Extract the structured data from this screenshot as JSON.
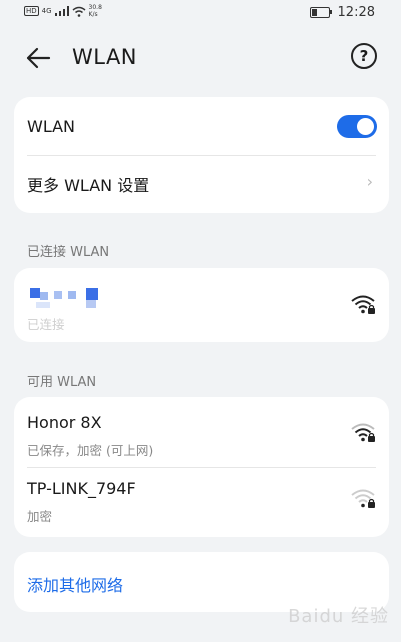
{
  "status_bar": {
    "network_badge": "HD",
    "signal_type": "4G",
    "speed_value": "30.8",
    "speed_unit": "K/s",
    "time": "12:28"
  },
  "header": {
    "title": "WLAN",
    "help_symbol": "?"
  },
  "settings_card": {
    "wlan_label": "WLAN",
    "wlan_enabled": true,
    "more_settings_label": "更多 WLAN 设置"
  },
  "connected": {
    "section_label": "已连接 WLAN",
    "network": {
      "status": "已连接",
      "signal_icon": "wifi-locked-full-icon"
    }
  },
  "available": {
    "section_label": "可用 WLAN",
    "networks": [
      {
        "name": "Honor 8X",
        "status": "已保存，加密 (可上网)",
        "signal_icon": "wifi-locked-strong-icon"
      },
      {
        "name": "TP-LINK_794F",
        "status": "加密",
        "signal_icon": "wifi-locked-weak-icon"
      }
    ]
  },
  "add_network": {
    "label": "添加其他网络"
  },
  "watermark": "Baidu 经验",
  "colors": {
    "accent": "#1e6ce8",
    "background": "#f1f3f5",
    "card": "#ffffff"
  }
}
